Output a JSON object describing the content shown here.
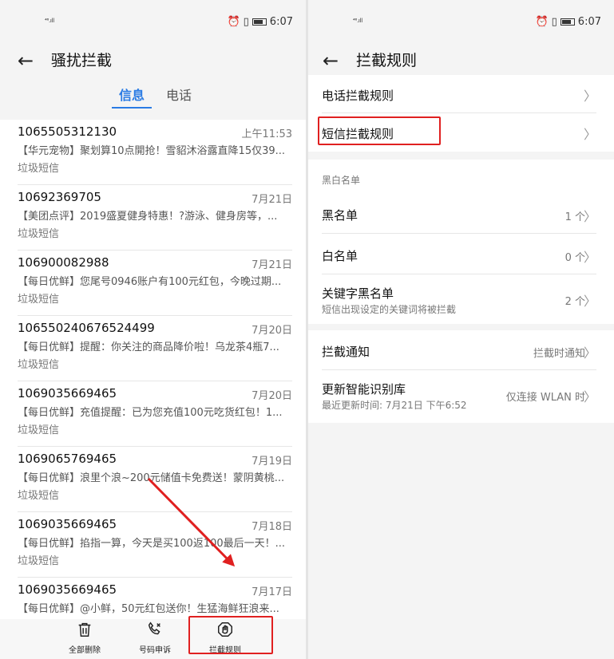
{
  "left": {
    "status": {
      "network": "⁴⁶.ıll",
      "time": "6:07"
    },
    "title": "骚扰拦截",
    "tabs": [
      {
        "label": "信息"
      },
      {
        "label": "电话"
      }
    ],
    "messages": [
      {
        "number": "1065505312130",
        "date": "上午11:53",
        "preview": "【华元宠物】聚划算10点開抢！雪貂沐浴露直降15仅39...",
        "tag": "垃圾短信"
      },
      {
        "number": "10692369705",
        "date": "7月21日",
        "preview": "【美团点评】2019盛夏健身特惠！?游泳、健身房等，...",
        "tag": "垃圾短信"
      },
      {
        "number": "106900082988",
        "date": "7月21日",
        "preview": "【每日优鲜】您尾号0946账户有100元红包，今晚过期...",
        "tag": "垃圾短信"
      },
      {
        "number": "106550240676524499",
        "date": "7月20日",
        "preview": "【每日优鲜】提醒：你关注的商品降价啦！乌龙茶4瓶7...",
        "tag": "垃圾短信"
      },
      {
        "number": "1069035669465",
        "date": "7月20日",
        "preview": "【每日优鲜】充值提醒：已为您充值100元吃货红包！1...",
        "tag": "垃圾短信"
      },
      {
        "number": "1069065769465",
        "date": "7月19日",
        "preview": "【每日优鲜】浪里个浪~200元储值卡免费送！蒙阴黄桃...",
        "tag": "垃圾短信"
      },
      {
        "number": "1069035669465",
        "date": "7月18日",
        "preview": "【每日优鲜】掐指一算，今天是买100返100最后一天！...",
        "tag": "垃圾短信"
      },
      {
        "number": "1069035669465",
        "date": "7月17日",
        "preview": "【每日优鲜】@小鲜，50元红包送你！生猛海鲜狂浪来...",
        "tag": ""
      }
    ],
    "bottom": [
      {
        "label": "全部删除",
        "icon": "trash-icon"
      },
      {
        "label": "号码申诉",
        "icon": "phone-appeal-icon"
      },
      {
        "label": "拦截规则",
        "icon": "block-rules-icon"
      }
    ]
  },
  "right": {
    "status": {
      "network": "⁴⁶.ıll",
      "time": "6:07"
    },
    "title": "拦截规则",
    "rules": {
      "phone": "电话拦截规则",
      "sms": "短信拦截规则"
    },
    "section_label": "黑白名单",
    "lists": {
      "black": {
        "label": "黑名单",
        "value": "1 个"
      },
      "white": {
        "label": "白名单",
        "value": "0 个"
      },
      "keyword": {
        "label": "关键字黑名单",
        "sub": "短信出现设定的关键词将被拦截",
        "value": "2 个"
      }
    },
    "notify": {
      "label": "拦截通知",
      "value": "拦截时通知"
    },
    "update": {
      "label": "更新智能识别库",
      "sub": "最近更新时间: 7月21日 下午6:52",
      "value": "仅连接 WLAN 时"
    }
  },
  "colors": {
    "accent": "#2a7be4",
    "annotation": "#e02020"
  }
}
